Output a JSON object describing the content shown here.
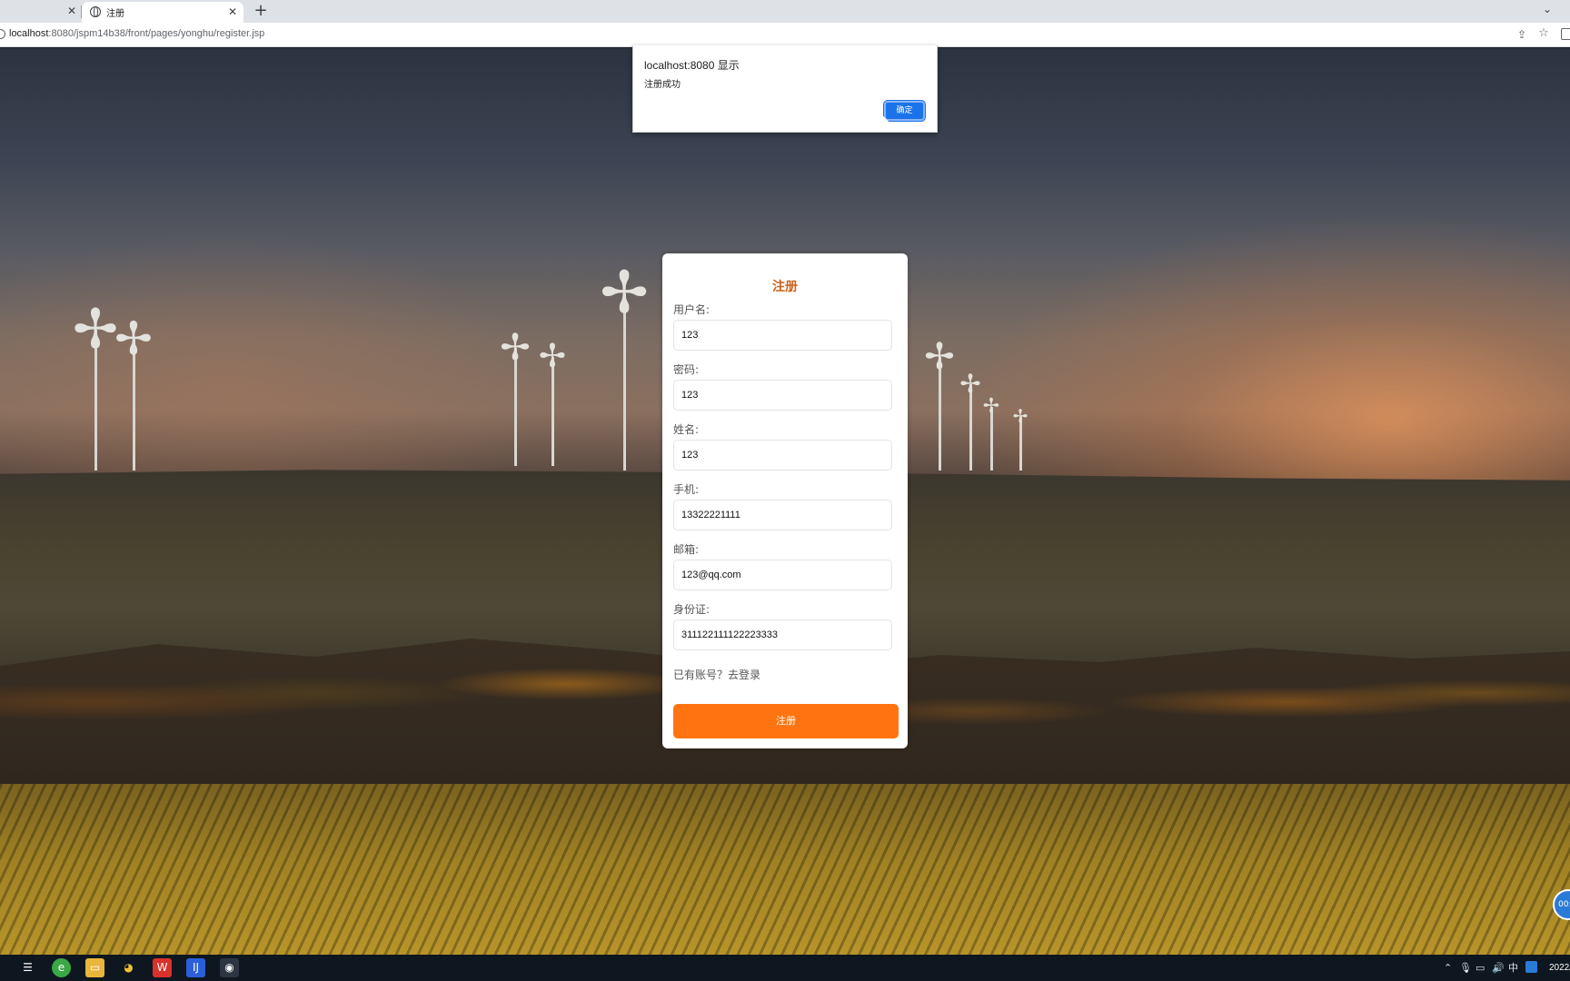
{
  "browser": {
    "tab_title": "注册",
    "url_host": "localhost",
    "url_rest": ":8080/jspm14b38/front/pages/yonghu/register.jsp",
    "icons": [
      "close-icon",
      "globe-icon",
      "plus-icon",
      "chevron-down-icon",
      "share-icon",
      "star-icon",
      "side-panel-icon"
    ]
  },
  "dialog": {
    "title": "localhost:8080 显示",
    "message": "注册成功",
    "ok_label": "确定"
  },
  "form": {
    "title": "注册",
    "fields": [
      {
        "label": "用户名:",
        "value": "123"
      },
      {
        "label": "密码:",
        "value": "123"
      },
      {
        "label": "姓名:",
        "value": "123"
      },
      {
        "label": "手机:",
        "value": "13322221111"
      },
      {
        "label": "邮箱:",
        "value": "123@qq.com"
      },
      {
        "label": "身份证:",
        "value": "311122111122223333"
      }
    ],
    "login_hint": "已有账号？去登录",
    "submit_label": "注册"
  },
  "record_widget": {
    "text": "00:"
  },
  "taskbar": {
    "tray_lang": "中",
    "clock": "2022/"
  },
  "colors": {
    "accent": "#ff7410",
    "title_orange": "#c9621a",
    "dialog_button": "#1a73e8"
  }
}
